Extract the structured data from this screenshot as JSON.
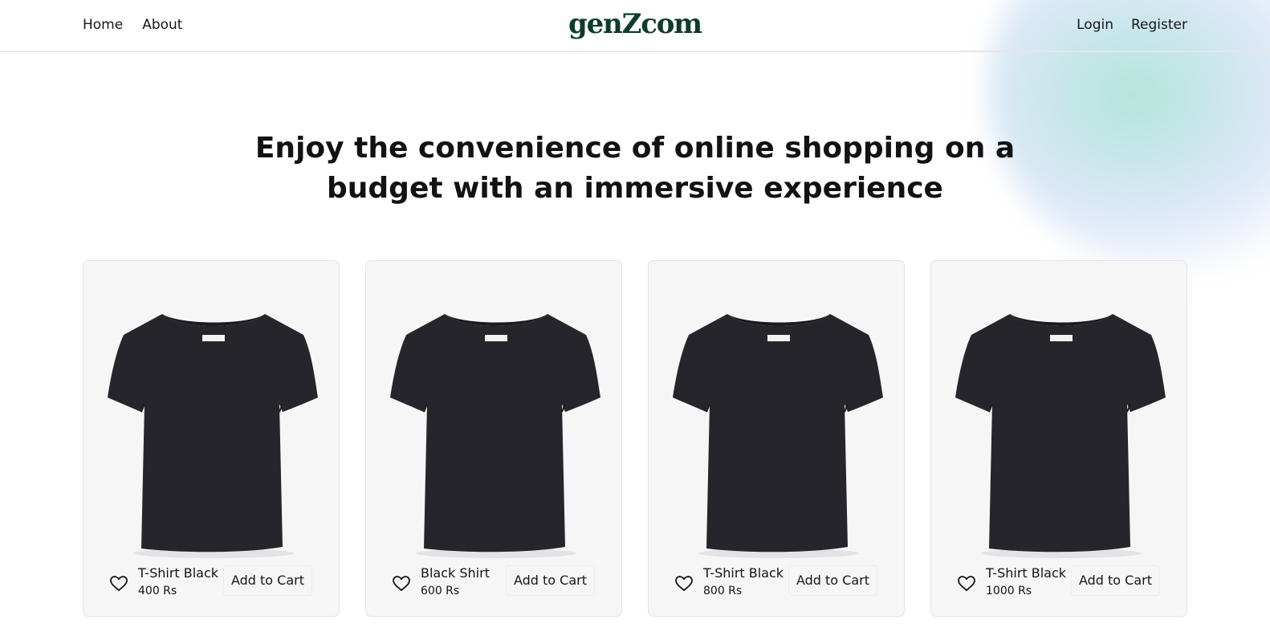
{
  "header": {
    "nav_left": [
      "Home",
      "About"
    ],
    "logo": "genZcom",
    "nav_right": [
      "Login",
      "Register"
    ]
  },
  "hero": {
    "line1": "Enjoy the convenience of online shopping on a",
    "line2": "budget with an immersive experience"
  },
  "products": [
    {
      "name": "T-Shirt Black",
      "price": "400 Rs",
      "cart_label": "Add to Cart",
      "image": "black-tshirt"
    },
    {
      "name": "Black Shirt",
      "price": "600 Rs",
      "cart_label": "Add to Cart",
      "image": "black-tshirt"
    },
    {
      "name": "T-Shirt Black",
      "price": "800 Rs",
      "cart_label": "Add to Cart",
      "image": "black-tshirt"
    },
    {
      "name": "T-Shirt Black",
      "price": "1000 Rs",
      "cart_label": "Add to Cart",
      "image": "black-tshirt"
    }
  ],
  "icons": {
    "wishlist": "heart-icon"
  },
  "colors": {
    "logo": "#0f3b2c",
    "card_bg": "#f6f6f7",
    "shirt": "#26252c"
  }
}
